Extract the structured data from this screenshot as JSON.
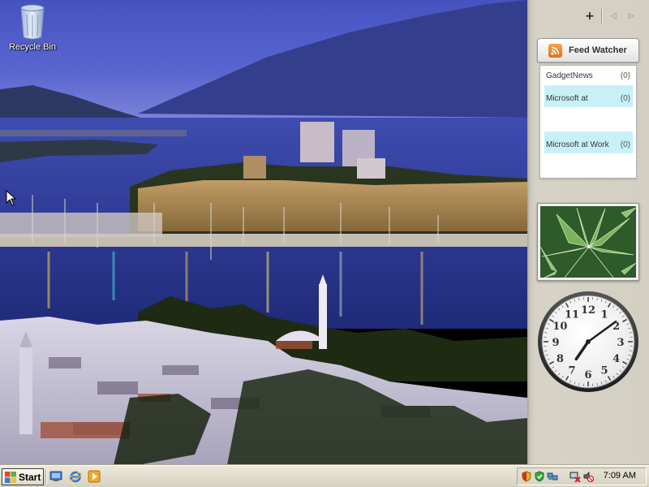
{
  "desktop": {
    "icons": [
      {
        "label": "Recycle Bin",
        "icon": "recycle-bin-icon"
      }
    ]
  },
  "sidebar": {
    "controls": {
      "add": "+",
      "prev": "◁",
      "next": "▷"
    },
    "feed_watcher": {
      "title": "Feed Watcher",
      "icon": "rss-icon",
      "items": [
        {
          "name": "GadgetNews",
          "count": "(0)"
        },
        {
          "name": "Microsoft at",
          "count": "(0)"
        },
        {
          "name": "Microsoft at Work",
          "count": "(0)"
        }
      ]
    },
    "slideshow": {
      "subject": "leaves-photo"
    },
    "clock": {
      "numerals": [
        "12",
        "1",
        "2",
        "3",
        "4",
        "5",
        "6",
        "7",
        "8",
        "9",
        "10",
        "11"
      ],
      "time": {
        "hour": 7,
        "minute": 9
      }
    }
  },
  "taskbar": {
    "start_label": "Start",
    "quick_launch": [
      "show-desktop-icon",
      "internet-explorer-icon",
      "media-player-icon"
    ],
    "tray_icons": [
      "security-shield-icon",
      "security-center-icon",
      "network-icon",
      "network-disconnected-icon",
      "volume-muted-icon"
    ],
    "clock": "7:09 AM"
  },
  "colors": {
    "sky": "#4f5cc8",
    "water": "#2f3e9a",
    "sidebar": "#d3cfc3",
    "feed_highlight": "#c7f1f7",
    "rss_orange": "#e8801f",
    "taskbar": "#ece9d8"
  }
}
